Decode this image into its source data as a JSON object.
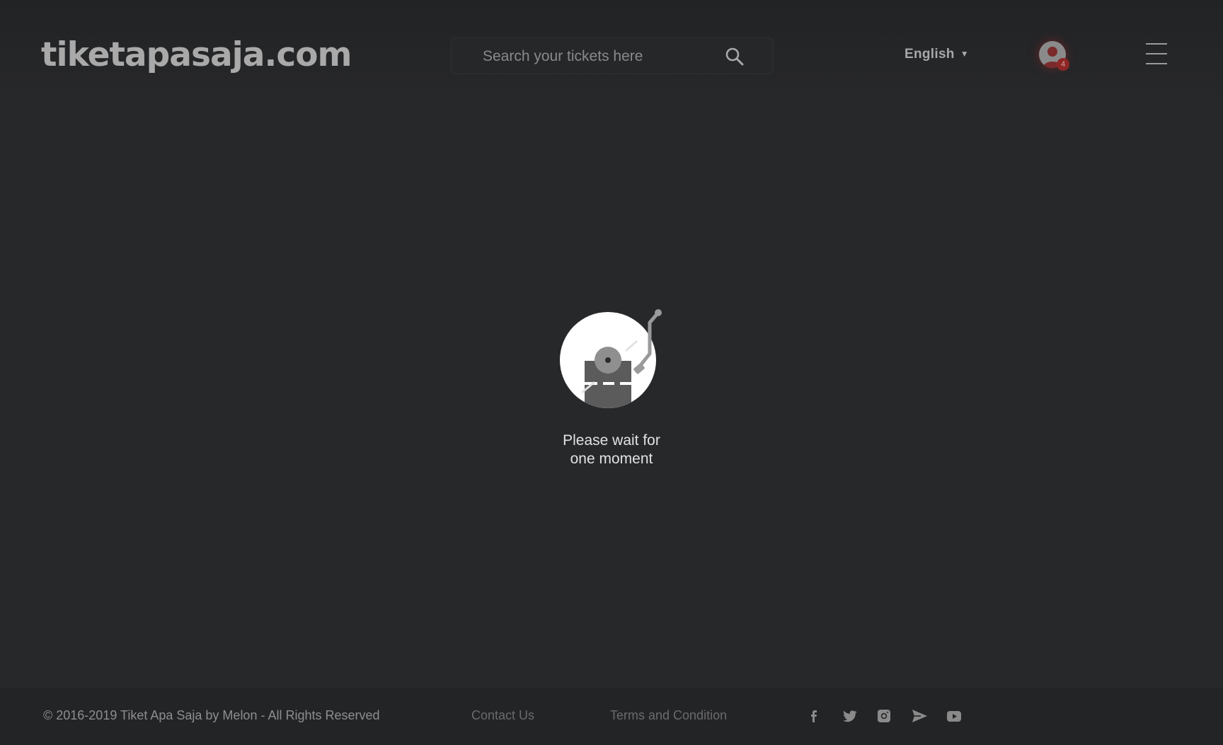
{
  "header": {
    "logo_text": "tiketapasaja.com",
    "search": {
      "placeholder": "Search your tickets here",
      "value": ""
    },
    "language": {
      "label": "English",
      "caret": "▼"
    },
    "notifications_count": "4"
  },
  "main": {
    "loading_text": "Please wait for\none moment"
  },
  "footer": {
    "copyright": "© 2016-2019 Tiket Apa Saja by Melon - All Rights Reserved",
    "links": [
      "Contact Us",
      "Terms and Condition"
    ],
    "social_icons": [
      "facebook-icon",
      "twitter-icon",
      "instagram-icon",
      "telegram-icon",
      "youtube-icon"
    ]
  },
  "colors": {
    "background": "#27282a",
    "footer_background": "#232426",
    "badge": "#8e2626"
  }
}
